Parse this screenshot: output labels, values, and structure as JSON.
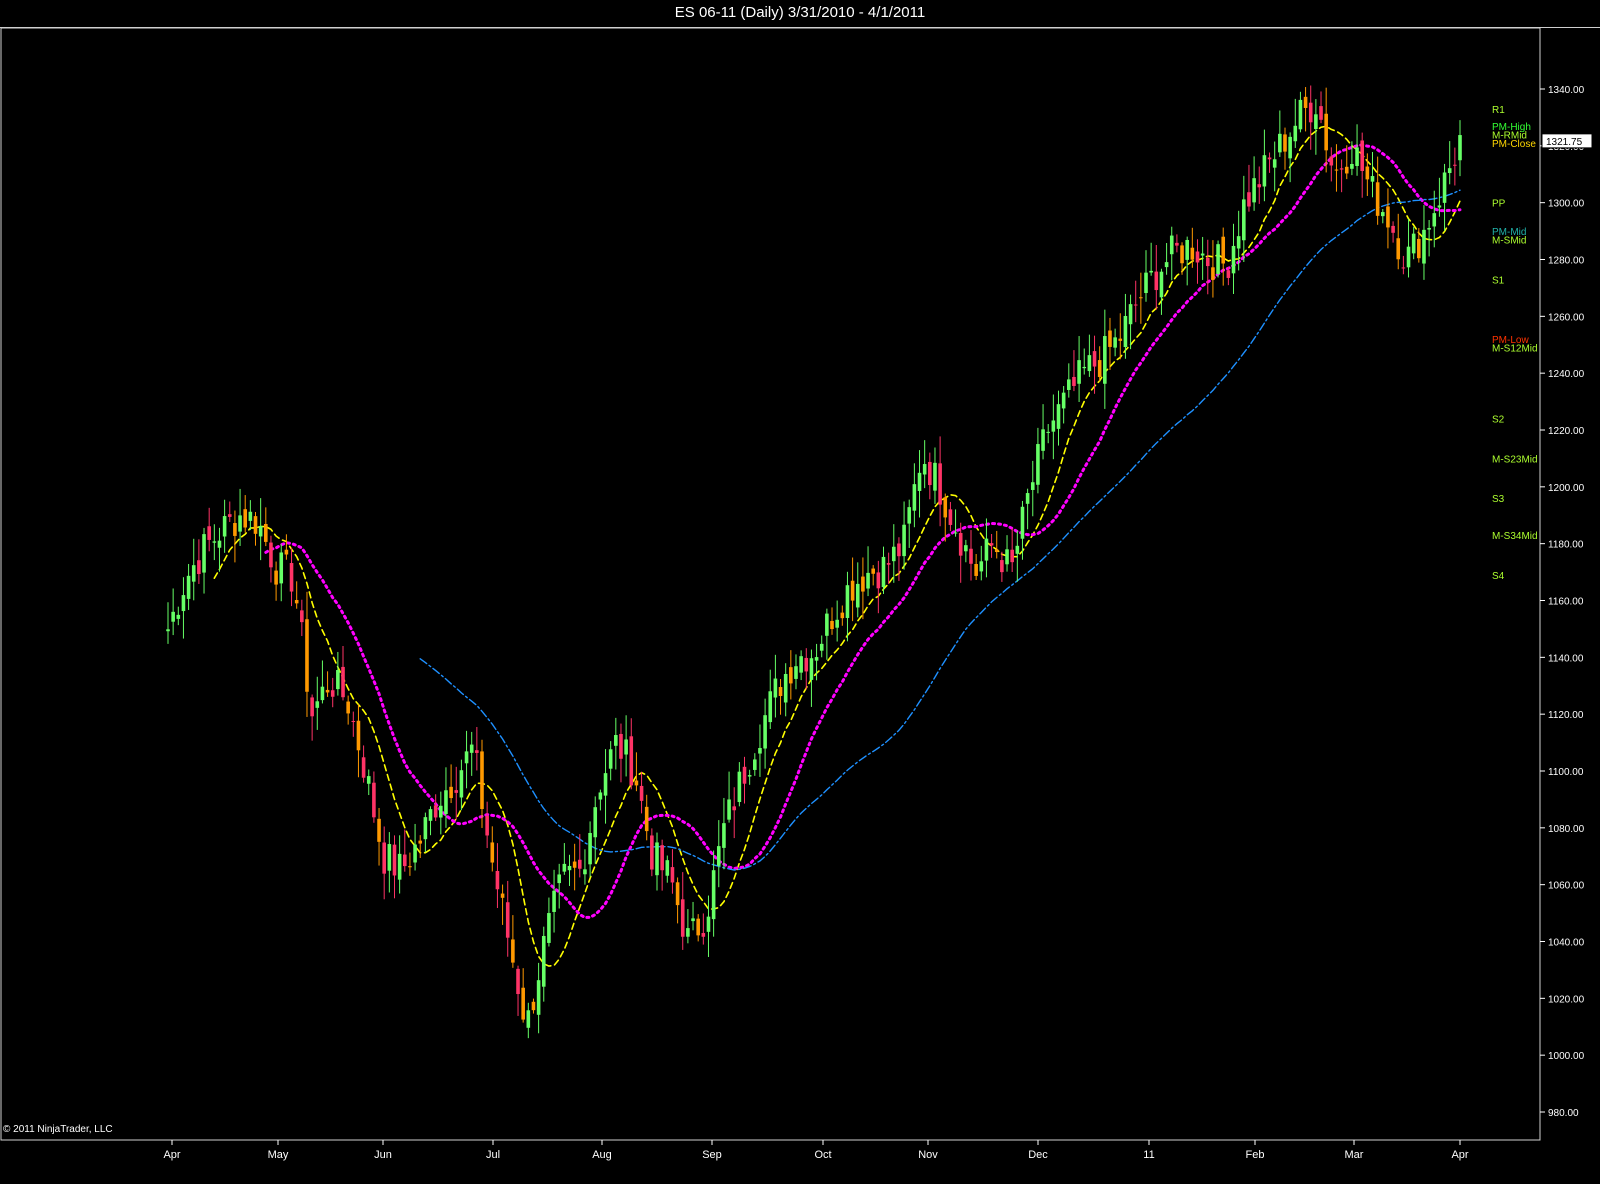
{
  "title": "ES 06-11 (Daily)  3/31/2010 - 4/1/2011",
  "copyright": "© 2011 NinjaTrader, LLC",
  "colors": {
    "background": "#000000",
    "up_candle": "#66ff66",
    "down_candle_early": "#ff9900",
    "down_candle_late": "#ff3366",
    "sma_fast": "#ffff00",
    "sma_mid": "#ff00ff",
    "sma_slow": "#1e90ff",
    "level_green": "#33ff33",
    "level_red": "#ff3300",
    "level_label": "#adff2f"
  },
  "chart_data": {
    "type": "candlestick",
    "symbol": "ES 06-11",
    "interval": "Daily",
    "ylim": [
      970,
      1350
    ],
    "y_ticks": [
      "1340.00",
      "1320.00",
      "1300.00",
      "1280.00",
      "1260.00",
      "1240.00",
      "1220.00",
      "1200.00",
      "1180.00",
      "1160.00",
      "1140.00",
      "1120.00",
      "1100.00",
      "1080.00",
      "1060.00",
      "1040.00",
      "1020.00",
      "1000.00",
      "980.00"
    ],
    "x_ticks": [
      "Apr",
      "May",
      "Jun",
      "Jul",
      "Aug",
      "Sep",
      "Oct",
      "Nov",
      "Dec",
      "11",
      "Feb",
      "Mar",
      "Apr"
    ],
    "last_price": "1321.75",
    "close_path": [
      [
        "Apr",
        1150
      ],
      [
        "Apr",
        1168
      ],
      [
        "Apr",
        1178
      ],
      [
        "Apr",
        1185
      ],
      [
        "Apr",
        1190
      ],
      [
        "Apr",
        1188
      ],
      [
        "May",
        1172
      ],
      [
        "May",
        1168
      ],
      [
        "May",
        1120
      ],
      [
        "May",
        1132
      ],
      [
        "May",
        1125
      ],
      [
        "May",
        1100
      ],
      [
        "Jun",
        1070
      ],
      [
        "Jun",
        1065
      ],
      [
        "Jun",
        1075
      ],
      [
        "Jun",
        1090
      ],
      [
        "Jun",
        1098
      ],
      [
        "Jun",
        1108
      ],
      [
        "Jul",
        1070
      ],
      [
        "Jul",
        1040
      ],
      [
        "Jul",
        1010
      ],
      [
        "Jul",
        1040
      ],
      [
        "Jul",
        1062
      ],
      [
        "Jul",
        1065
      ],
      [
        "Aug",
        1095
      ],
      [
        "Aug",
        1110
      ],
      [
        "Aug",
        1100
      ],
      [
        "Aug",
        1070
      ],
      [
        "Aug",
        1062
      ],
      [
        "Aug",
        1040
      ],
      [
        "Sep",
        1050
      ],
      [
        "Sep",
        1080
      ],
      [
        "Sep",
        1098
      ],
      [
        "Sep",
        1115
      ],
      [
        "Sep",
        1130
      ],
      [
        "Sep",
        1140
      ],
      [
        "Oct",
        1142
      ],
      [
        "Oct",
        1155
      ],
      [
        "Oct",
        1165
      ],
      [
        "Oct",
        1170
      ],
      [
        "Oct",
        1172
      ],
      [
        "Oct",
        1180
      ],
      [
        "Nov",
        1212
      ],
      [
        "Nov",
        1200
      ],
      [
        "Nov",
        1185
      ],
      [
        "Nov",
        1170
      ],
      [
        "Nov",
        1180
      ],
      [
        "Nov",
        1170
      ],
      [
        "Dec",
        1198
      ],
      [
        "Dec",
        1220
      ],
      [
        "Dec",
        1230
      ],
      [
        "Dec",
        1240
      ],
      [
        "Dec",
        1245
      ],
      [
        "Dec",
        1252
      ],
      [
        "11",
        1265
      ],
      [
        "11",
        1275
      ],
      [
        "11",
        1282
      ],
      [
        "11",
        1285
      ],
      [
        "11",
        1280
      ],
      [
        "11",
        1278
      ],
      [
        "Feb",
        1300
      ],
      [
        "Feb",
        1310
      ],
      [
        "Feb",
        1320
      ],
      [
        "Feb",
        1330
      ],
      [
        "Feb",
        1336
      ],
      [
        "Feb",
        1310
      ],
      [
        "Mar",
        1320
      ],
      [
        "Mar",
        1305
      ],
      [
        "Mar",
        1295
      ],
      [
        "Mar",
        1280
      ],
      [
        "Mar",
        1290
      ],
      [
        "Mar",
        1305
      ],
      [
        "Apr",
        1322
      ]
    ],
    "series": [
      {
        "name": "",
        "style": "dashed",
        "color": "#ffff00"
      },
      {
        "name": "",
        "style": "dotted",
        "color": "#ff00ff"
      },
      {
        "name": "",
        "style": "dash-dot",
        "color": "#1e90ff"
      }
    ],
    "levels": [
      {
        "label": "R1",
        "value": 1333,
        "color": "#adff2f"
      },
      {
        "label": "PM-High",
        "value": 1327,
        "color": "#33ff33"
      },
      {
        "label": "M-RMid",
        "value": 1324,
        "color": "#adff2f"
      },
      {
        "label": "PM-Close",
        "value": 1321,
        "color": "#ffd700"
      },
      {
        "label": "PP",
        "value": 1300,
        "color": "#adff2f"
      },
      {
        "label": "PM-Mid",
        "value": 1290,
        "color": "#20b2aa"
      },
      {
        "label": "M-SMid",
        "value": 1287,
        "color": "#adff2f"
      },
      {
        "label": "S1",
        "value": 1273,
        "color": "#adff2f"
      },
      {
        "label": "PM-Low",
        "value": 1252,
        "color": "#ff3300"
      },
      {
        "label": "M-S12Mid",
        "value": 1249,
        "color": "#adff2f"
      },
      {
        "label": "S2",
        "value": 1224,
        "color": "#adff2f"
      },
      {
        "label": "M-S23Mid",
        "value": 1210,
        "color": "#adff2f"
      },
      {
        "label": "S3",
        "value": 1196,
        "color": "#adff2f"
      },
      {
        "label": "M-S34Mid",
        "value": 1183,
        "color": "#adff2f"
      },
      {
        "label": "S4",
        "value": 1169,
        "color": "#adff2f"
      }
    ],
    "grid": false,
    "legend": "none"
  }
}
